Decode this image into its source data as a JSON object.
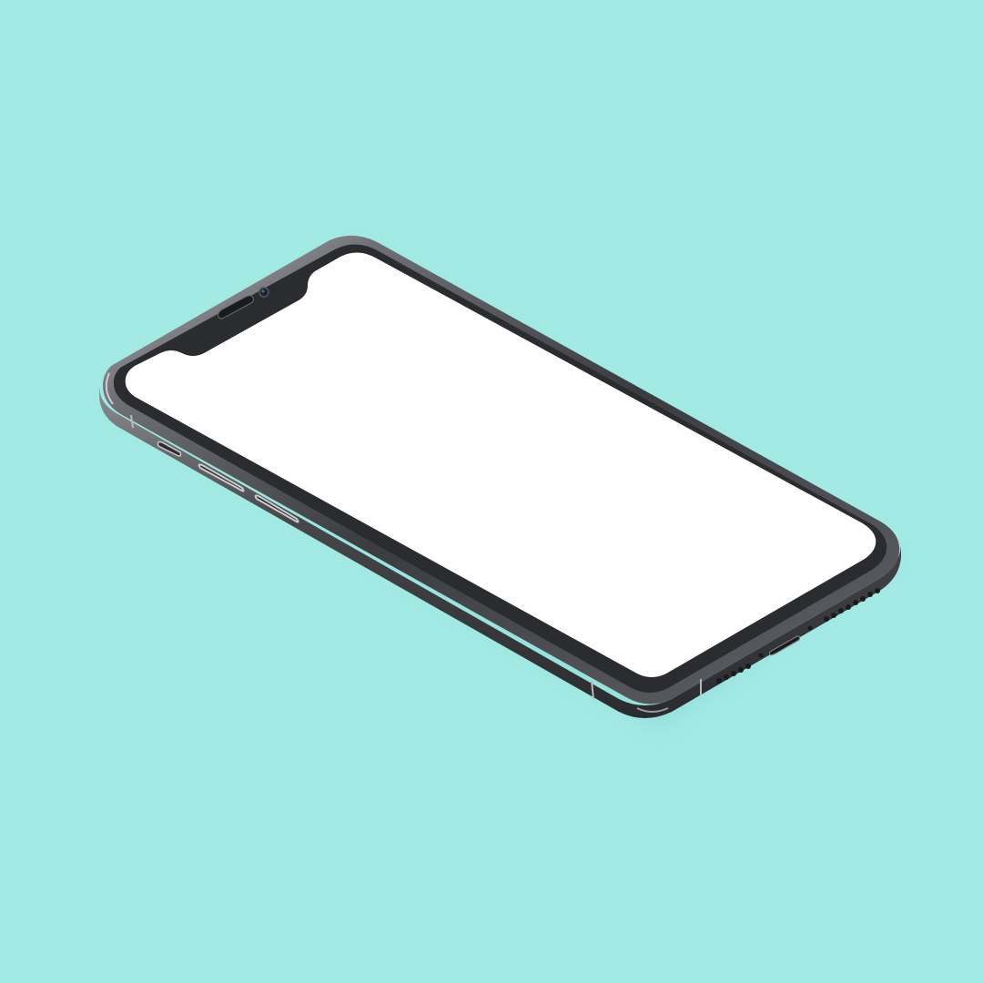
{
  "scene": {
    "subject": "phone-mockup-isometric",
    "background_color": "#a3e9e4",
    "frame_color": "#3a3c40",
    "frame_highlight_color": "#9a9ca0",
    "bezel_color": "#2b2c30",
    "screen_color": "#ffffff",
    "shadow_color": "#7fcfca"
  }
}
